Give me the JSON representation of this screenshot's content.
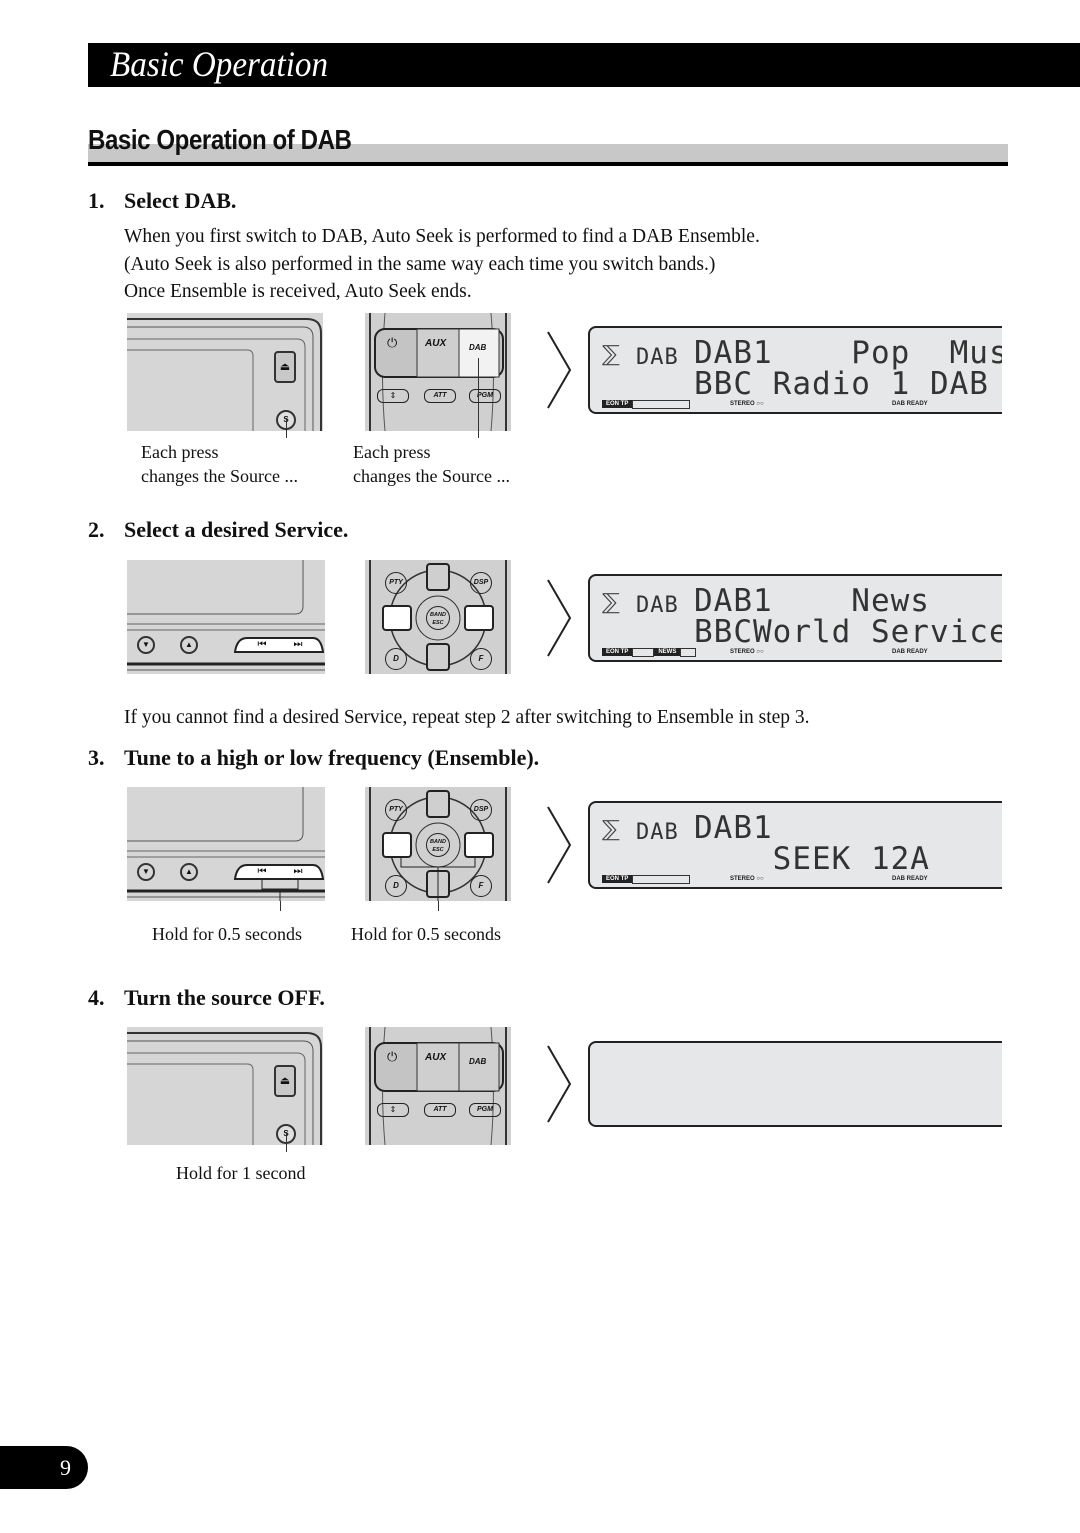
{
  "header": {
    "chapter_title": "Basic Operation"
  },
  "section": {
    "title": "Basic Operation of DAB"
  },
  "steps": [
    {
      "number": "1.",
      "title": "Select DAB.",
      "paragraphs": [
        "When you first switch to DAB, Auto Seek is performed to find a DAB Ensemble.",
        "(Auto Seek is also performed in the same way each time you switch bands.)",
        "Once Ensemble is received, Auto Seek ends."
      ],
      "captions": [
        {
          "line1": "Each press",
          "line2": "changes the Source ..."
        },
        {
          "line1": "Each press",
          "line2": "changes the Source ..."
        }
      ],
      "display": {
        "line1": "DAB1    Pop  Mus",
        "line2": "BBC Radio 1 DAB",
        "indicators": {
          "eon_tp": "EON  TP",
          "news": "",
          "stereo": "STEREO ○○",
          "dab_ready": "DAB READY"
        }
      }
    },
    {
      "number": "2.",
      "title": "Select a desired Service.",
      "display": {
        "line1": "DAB1    News",
        "line2": "BBCWorld Service",
        "indicators": {
          "eon_tp": "EON  TP",
          "news": "NEWS",
          "stereo": "STEREO ○○",
          "dab_ready": "DAB READY"
        }
      },
      "note": "If you cannot find a desired Service, repeat step 2 after switching to Ensemble in step 3."
    },
    {
      "number": "3.",
      "title": "Tune to a high or low frequency (Ensemble).",
      "captions": [
        {
          "line1": "Hold for 0.5 seconds"
        },
        {
          "line1": "Hold for 0.5 seconds"
        }
      ],
      "display": {
        "line1": "DAB1",
        "line2": "    SEEK 12A",
        "indicators": {
          "eon_tp": "EON  TP",
          "news": "",
          "stereo": "STEREO ○○",
          "dab_ready": "DAB READY"
        }
      }
    },
    {
      "number": "4.",
      "title": "Turn the source OFF.",
      "captions": [
        {
          "line1": "Hold for 1 second"
        }
      ],
      "display": {
        "line1": "",
        "line2": ""
      }
    }
  ],
  "buttons": {
    "eject": "⏏",
    "source": "S",
    "aux": "AUX",
    "dab": "DAB",
    "att": "ATT",
    "pgm": "PGM",
    "pty": "PTY",
    "dsp": "DSP",
    "band": "BAND",
    "esc": "ESC",
    "d": "D",
    "f": "F",
    "prev_track": "⏮",
    "next_track": "⏭",
    "down": "▼",
    "up": "▲"
  },
  "lcd_icon_label": "DAB",
  "footer": {
    "page_number": "9"
  }
}
